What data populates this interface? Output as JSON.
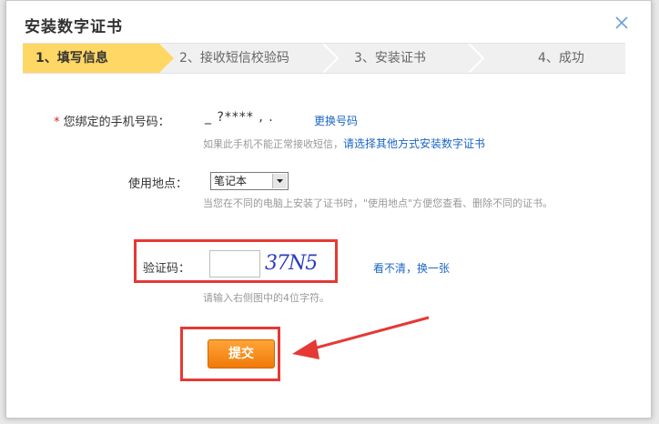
{
  "dialog": {
    "title": "安装数字证书",
    "close_icon": "close-icon"
  },
  "steps": [
    {
      "label": "1、填写信息",
      "active": true
    },
    {
      "label": "2、接收短信校验码",
      "active": false
    },
    {
      "label": "3、安装证书",
      "active": false
    },
    {
      "label": "4、成功",
      "active": false
    }
  ],
  "phone": {
    "required_mark": "*",
    "label": "您绑定的手机号码：",
    "value": "_ ?****  ,  .",
    "change_link": "更换号码",
    "hint_prefix": "如果此手机不能正常接收短信，",
    "hint_link": "请选择其他方式安装数字证书"
  },
  "location": {
    "label": "使用地点：",
    "selected": "笔记本",
    "hint": "当您在不同的电脑上安装了证书时，\"使用地点\"方便您查看、删除不同的证书。"
  },
  "captcha": {
    "label": "验证码：",
    "input_value": "",
    "image_text": "37N5",
    "refresh_link": "看不清，换一张",
    "hint": "请输入右侧图中的4位字符。"
  },
  "submit": {
    "label": "提交"
  },
  "colors": {
    "active_step": "#ffd765",
    "link": "#1a66c5",
    "highlight": "#e53935",
    "button": "#f08a1a"
  }
}
